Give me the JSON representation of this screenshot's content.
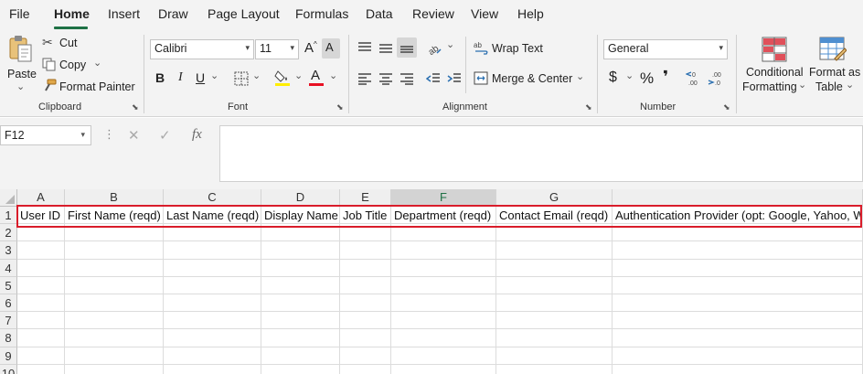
{
  "menu": {
    "tabs": [
      "File",
      "Home",
      "Insert",
      "Draw",
      "Page Layout",
      "Formulas",
      "Data",
      "Review",
      "View",
      "Help"
    ],
    "active": "Home"
  },
  "ribbon": {
    "clipboard": {
      "paste": "Paste",
      "cut": "Cut",
      "copy": "Copy",
      "format_painter": "Format Painter",
      "label": "Clipboard"
    },
    "font": {
      "name": "Calibri",
      "size": "11",
      "bold": "B",
      "italic": "I",
      "underline": "U",
      "grow": "A",
      "shrink": "A",
      "font_color_letter": "A",
      "label": "Font"
    },
    "alignment": {
      "wrap_text": "Wrap Text",
      "merge_center": "Merge & Center",
      "label": "Alignment"
    },
    "number": {
      "format": "General",
      "currency": "$",
      "percent": "%",
      "comma": "❜",
      "label": "Number"
    },
    "styles": {
      "conditional_formatting_1": "Conditional",
      "conditional_formatting_2": "Formatting",
      "format_as_table_1": "Format as",
      "format_as_table_2": "Table"
    }
  },
  "formula_bar": {
    "name_box": "F12",
    "fx": "fx",
    "value": ""
  },
  "sheet": {
    "columns": [
      "A",
      "B",
      "C",
      "D",
      "E",
      "F",
      "G"
    ],
    "selected_column": "F",
    "rows": [
      "1",
      "2",
      "3",
      "4",
      "5",
      "6",
      "7",
      "8",
      "9",
      "10"
    ],
    "headers": [
      "User ID",
      "First Name (reqd)",
      "Last Name (reqd)",
      "Display Name",
      "Job Title",
      "Department (reqd)",
      "Contact Email (reqd)",
      "Authentication Provider (opt: Google, Yahoo, W"
    ]
  },
  "colors": {
    "accent": "#1e7145",
    "highlight": "#d91c2a",
    "font_color_bar": "#e81123",
    "fill_color_bar": "#ffee00"
  }
}
